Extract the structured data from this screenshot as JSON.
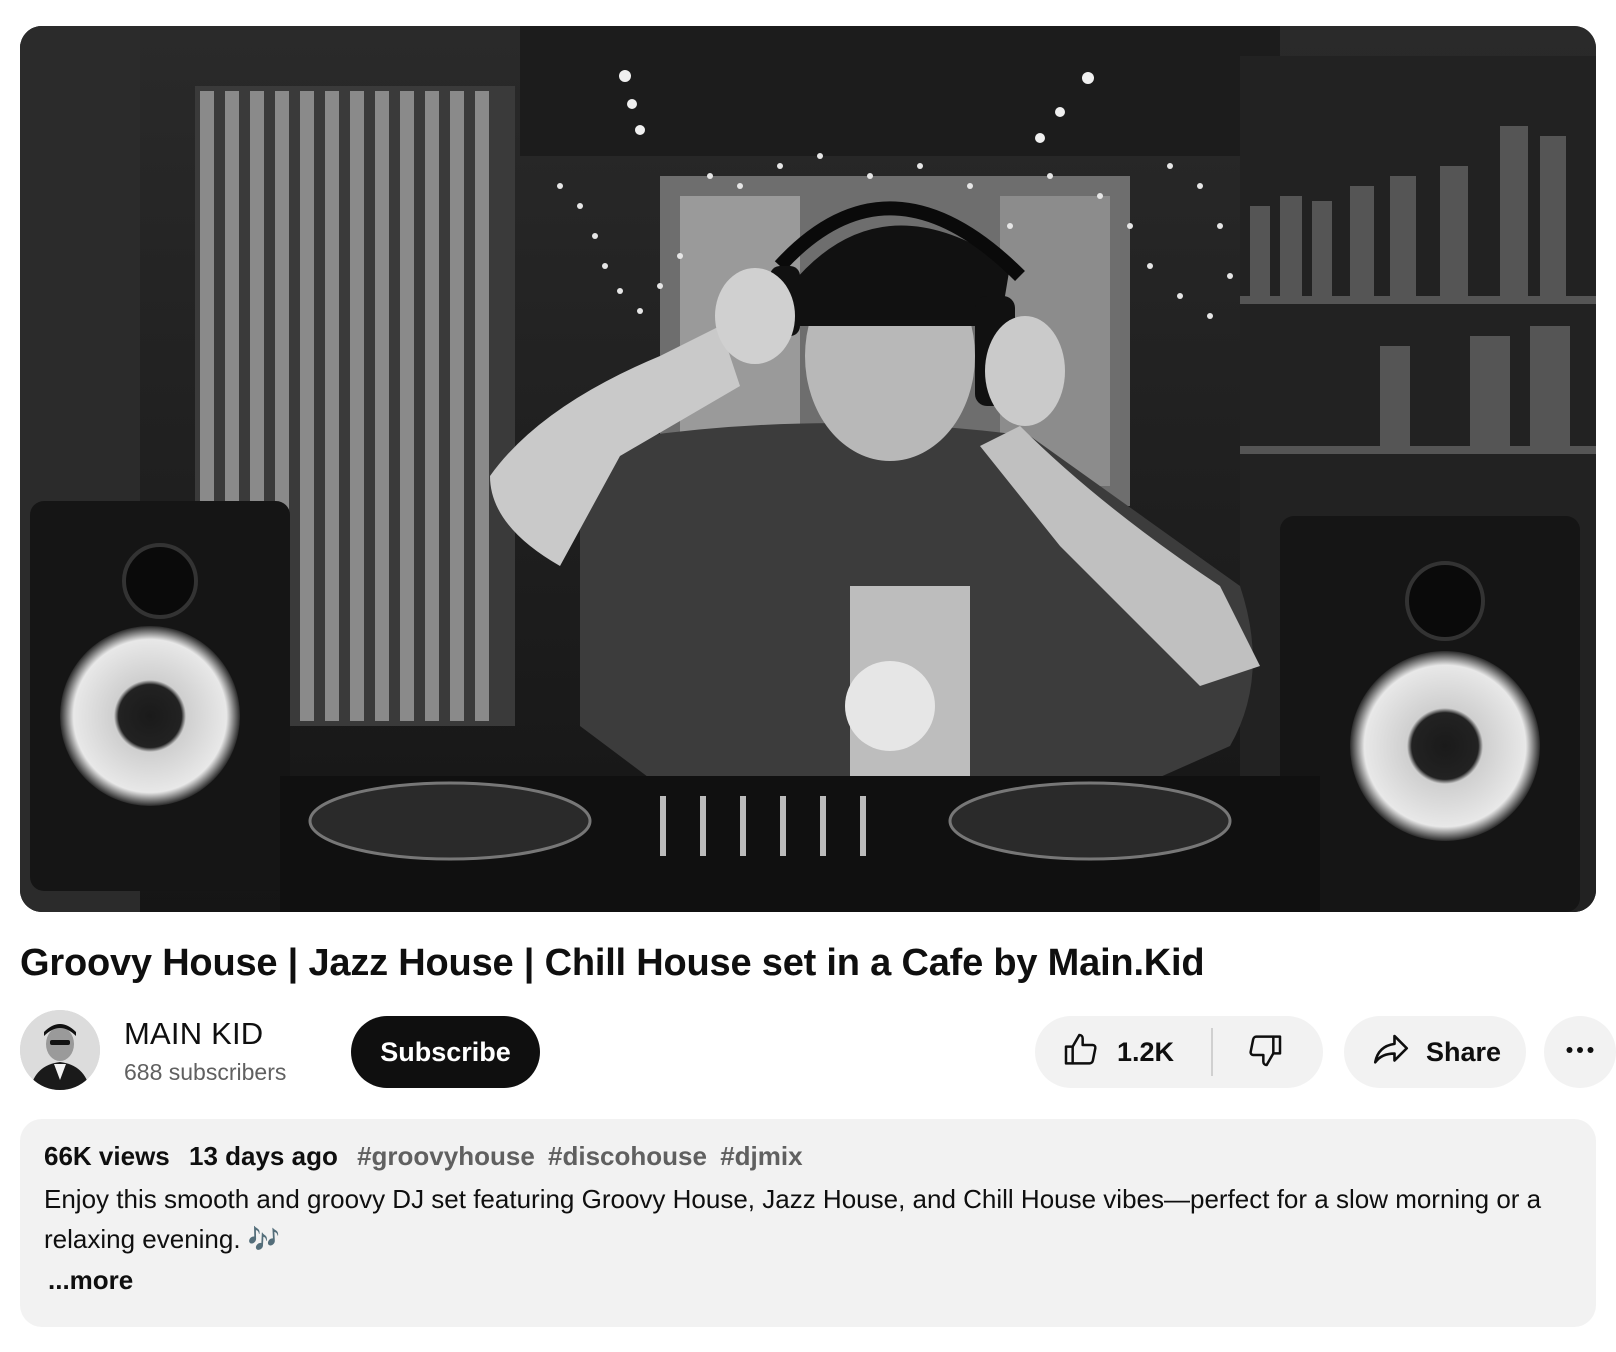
{
  "video": {
    "title": "Groovy House | Jazz House | Chill House set in a Cafe by Main.Kid"
  },
  "channel": {
    "name": "MAIN KID",
    "subscribers": "688 subscribers",
    "subscribe_label": "Subscribe"
  },
  "actions": {
    "like_count": "1.2K",
    "share_label": "Share",
    "like_icon": "thumbs-up-icon",
    "dislike_icon": "thumbs-down-icon",
    "share_icon": "share-arrow-icon",
    "more_icon": "more-horizontal-icon"
  },
  "description": {
    "views": "66K views",
    "age": "13 days ago",
    "hashtags": [
      "#groovyhouse",
      "#discohouse",
      "#djmix"
    ],
    "text": "Enjoy this smooth and groovy DJ set featuring Groovy House, Jazz House, and Chill House vibes—perfect for a slow morning or a relaxing evening. 🎶",
    "more_label": "...more"
  },
  "colors": {
    "text_primary": "#0f0f0f",
    "text_secondary": "#606060",
    "button_bg": "#f2f2f2",
    "subscribe_bg": "#0f0f0f"
  }
}
